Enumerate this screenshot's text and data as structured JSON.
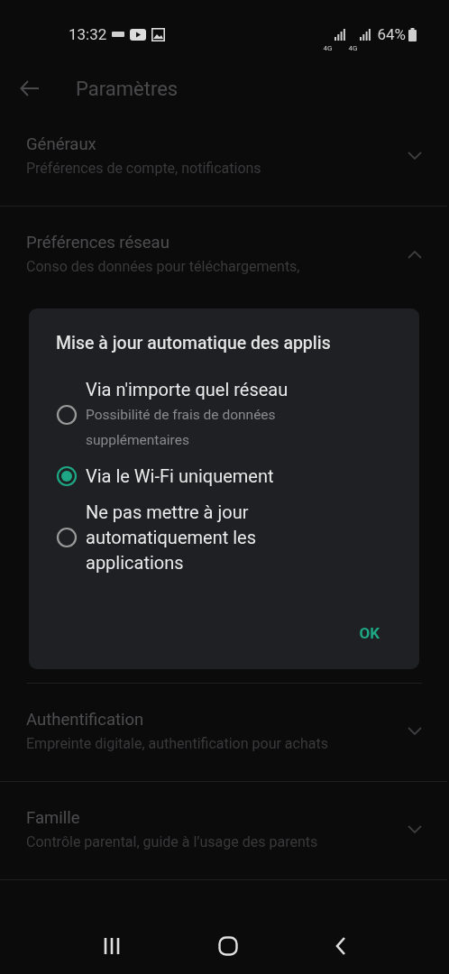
{
  "status_bar": {
    "time": "13:32",
    "network_labels": [
      "4G",
      "4G"
    ],
    "battery": "64%"
  },
  "app_bar": {
    "title": "Paramètres"
  },
  "sections": [
    {
      "title": "Généraux",
      "subtitle": "Préférences de compte, notifications",
      "expanded": false
    },
    {
      "title": "Préférences réseau",
      "subtitle": "Conso des données pour téléchargements,",
      "expanded": true
    },
    {
      "title": "Authentification",
      "subtitle": "Empreinte digitale, authentification pour achats",
      "expanded": false
    },
    {
      "title": "Famille",
      "subtitle": "Contrôle parental, guide à l’usage des parents",
      "expanded": false
    }
  ],
  "dialog": {
    "title": "Mise à jour automatique des applis",
    "options": [
      {
        "label": "Via n'importe quel réseau",
        "description": "Possibilité de frais de données supplémentaires",
        "selected": false
      },
      {
        "label": "Via le Wi-Fi uniquement",
        "selected": true
      },
      {
        "label": "Ne pas mettre à jour automatiquement les applications",
        "selected": false
      }
    ],
    "button": "OK"
  }
}
